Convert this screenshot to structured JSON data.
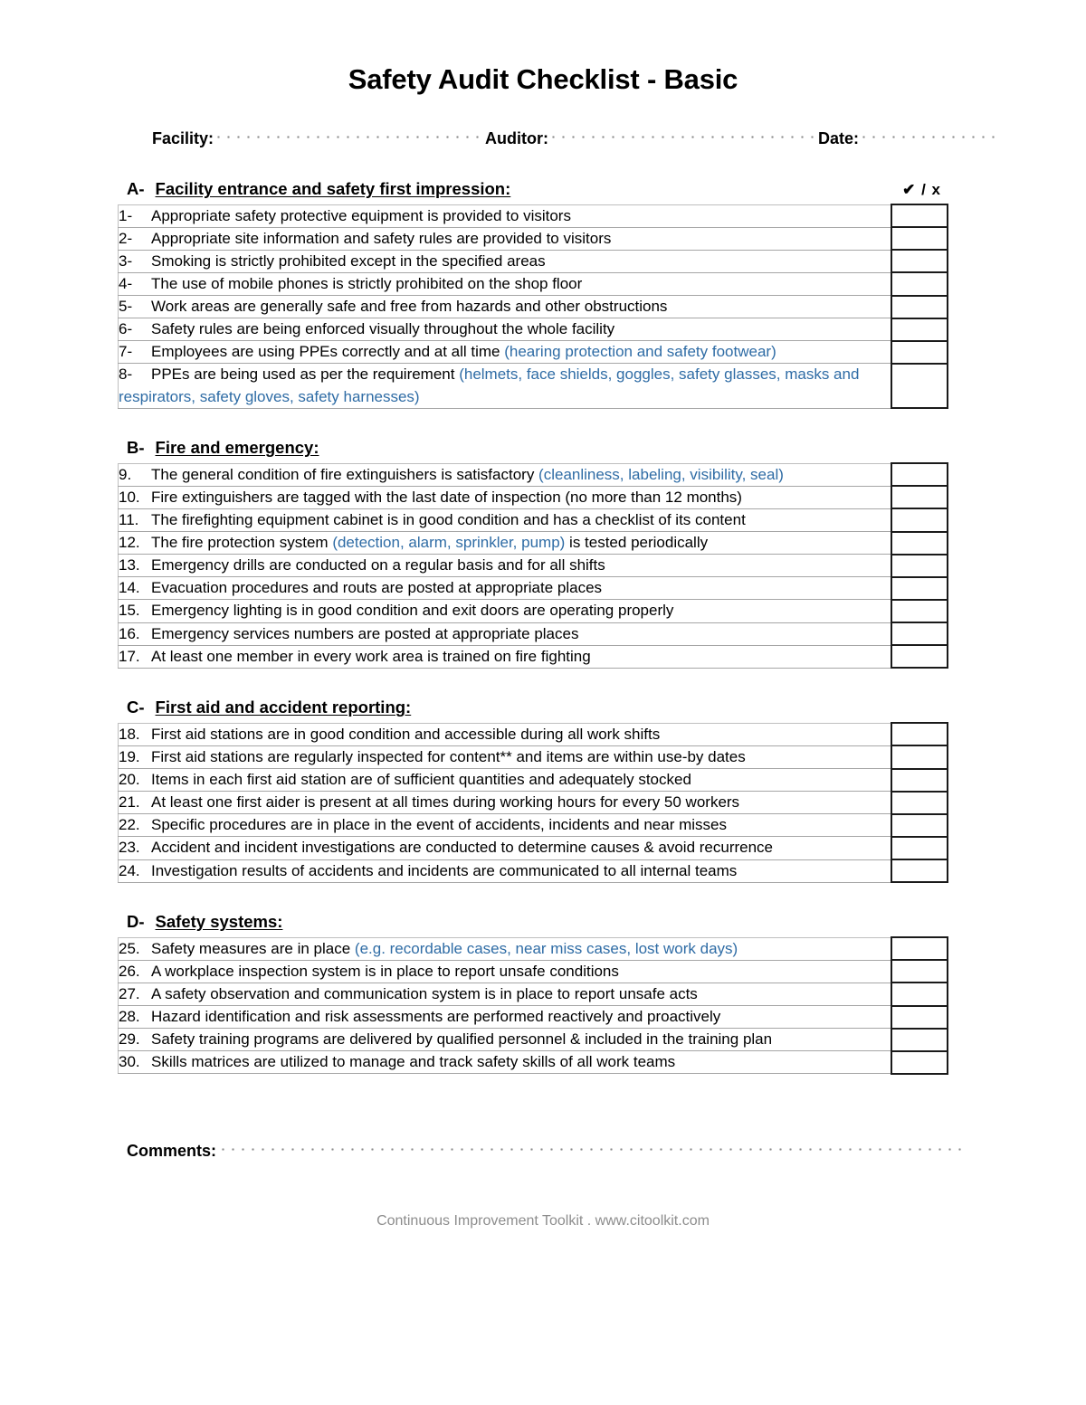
{
  "document": {
    "title": "Safety Audit Checklist - Basic",
    "tick_legend": "✔ / x"
  },
  "meta": {
    "facility_label": "Facility:",
    "facility_value": "",
    "auditor_label": "Auditor:",
    "auditor_value": "",
    "date_label": "Date:",
    "date_value": ""
  },
  "sections": [
    {
      "letter": "A-",
      "title": "Facility entrance and safety first impression:",
      "items": [
        {
          "num": "1-",
          "text": "Appropriate safety protective equipment is provided to visitors",
          "note": "",
          "checked": ""
        },
        {
          "num": "2-",
          "text": "Appropriate site information and safety rules are provided to visitors",
          "note": "",
          "checked": ""
        },
        {
          "num": "3-",
          "text": "Smoking is strictly prohibited except in the specified areas",
          "note": "",
          "checked": ""
        },
        {
          "num": "4-",
          "text": "The use of mobile phones is strictly prohibited on the shop floor",
          "note": "",
          "checked": ""
        },
        {
          "num": "5-",
          "text": "Work areas are generally safe and free from hazards and other obstructions",
          "note": "",
          "checked": ""
        },
        {
          "num": "6-",
          "text": "Safety rules are being enforced visually throughout the whole facility",
          "note": "",
          "checked": ""
        },
        {
          "num": "7-",
          "text": "Employees are using PPEs correctly and at all time ",
          "note": "(hearing protection and safety footwear)",
          "checked": ""
        },
        {
          "num": "8-",
          "text": "PPEs are being used as per the requirement ",
          "note": "(helmets, face shields, goggles, safety glasses, masks and respirators, safety gloves, safety harnesses)",
          "checked": ""
        }
      ]
    },
    {
      "letter": "B-",
      "title": "Fire and emergency:",
      "items": [
        {
          "num": "9.",
          "text": "The general condition of fire extinguishers is satisfactory ",
          "note": "(cleanliness, labeling, visibility, seal)",
          "checked": ""
        },
        {
          "num": "10.",
          "text": "Fire extinguishers are tagged with the last date of inspection (no more than 12 months)",
          "note": "",
          "checked": ""
        },
        {
          "num": "11.",
          "text": "The firefighting equipment cabinet is in good condition and has a checklist of its content",
          "note": "",
          "checked": ""
        },
        {
          "num": "12.",
          "text": "The fire protection system ",
          "note": "(detection, alarm,  sprinkler, pump)",
          "text_after": " is tested periodically",
          "checked": ""
        },
        {
          "num": "13.",
          "text": "Emergency drills are conducted on a regular basis and for all shifts",
          "note": "",
          "checked": ""
        },
        {
          "num": "14.",
          "text": "Evacuation procedures and routs are posted at appropriate places",
          "note": "",
          "checked": ""
        },
        {
          "num": "15.",
          "text": "Emergency lighting is in good condition and exit doors are operating properly",
          "note": "",
          "checked": ""
        },
        {
          "num": "16.",
          "text": "Emergency services numbers are posted at appropriate places",
          "note": "",
          "checked": ""
        },
        {
          "num": "17.",
          "text": "At least one member in every work area is trained on fire fighting",
          "note": "",
          "checked": ""
        }
      ]
    },
    {
      "letter": "C-",
      "title": "First aid and accident reporting:",
      "items": [
        {
          "num": "18.",
          "text": "First aid stations are in good condition and accessible during all work shifts",
          "note": "",
          "checked": ""
        },
        {
          "num": "19.",
          "text": "First aid stations are regularly inspected for content** and items are within use-by dates",
          "note": "",
          "checked": ""
        },
        {
          "num": "20.",
          "text": "Items in each first aid station are of sufficient quantities and adequately stocked",
          "note": "",
          "checked": ""
        },
        {
          "num": "21.",
          "text": "At least one first aider is present at all times during working hours for every 50 workers",
          "note": "",
          "checked": ""
        },
        {
          "num": "22.",
          "text": "Specific procedures are in place in the event of accidents, incidents and near misses",
          "note": "",
          "checked": ""
        },
        {
          "num": "23.",
          "text": "Accident and incident investigations are conducted to determine causes & avoid recurrence",
          "note": "",
          "checked": ""
        },
        {
          "num": "24.",
          "text": "Investigation results of accidents and incidents are communicated to all internal teams",
          "note": "",
          "checked": ""
        }
      ]
    },
    {
      "letter": "D-",
      "title": "Safety systems:",
      "items": [
        {
          "num": "25.",
          "text": "Safety measures are in place ",
          "note": "(e.g. recordable cases, near miss cases, lost work days)",
          "checked": ""
        },
        {
          "num": "26.",
          "text": "A workplace inspection system is in place to report unsafe conditions",
          "note": "",
          "checked": ""
        },
        {
          "num": "27.",
          "text": "A safety observation and communication system is in place to report unsafe acts",
          "note": "",
          "checked": ""
        },
        {
          "num": "28.",
          "text": "Hazard identification and risk assessments are performed reactively and proactively",
          "note": "",
          "checked": ""
        },
        {
          "num": "29.",
          "text": "Safety training programs are delivered by qualified personnel & included in the training plan",
          "note": "",
          "checked": ""
        },
        {
          "num": "30.",
          "text": "Skills matrices are utilized to manage and track safety skills of all work teams",
          "note": "",
          "checked": ""
        }
      ]
    }
  ],
  "comments": {
    "label": "Comments:",
    "value": ""
  },
  "footer": {
    "text": "Continuous Improvement Toolkit . www.citoolkit.com"
  },
  "colors": {
    "note_blue": "#2f6ca5",
    "grid_gray": "#bfbfbf",
    "box_border": "#1a1a1a",
    "footer_gray": "#8d8d8d"
  }
}
